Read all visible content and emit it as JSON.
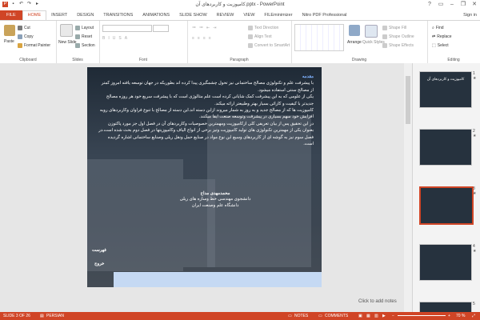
{
  "window": {
    "title": "کامپوزیت و کاربردهای آن.pptx - PowerPoint",
    "help": "?",
    "signin": "Sign in"
  },
  "tabs": [
    "FILE",
    "HOME",
    "INSERT",
    "DESIGN",
    "TRANSITIONS",
    "ANIMATIONS",
    "SLIDE SHOW",
    "REVIEW",
    "VIEW",
    "FILEminimizer",
    "Nitro PDF Professional"
  ],
  "ribbon": {
    "clipboard": {
      "name": "Clipboard",
      "paste": "Paste",
      "cut": "Cut",
      "copy": "Copy",
      "format_painter": "Format Painter"
    },
    "slides": {
      "name": "Slides",
      "new_slide": "New Slide",
      "layout": "Layout",
      "reset": "Reset",
      "section": "Section"
    },
    "font": {
      "name": "Font"
    },
    "paragraph": {
      "name": "Paragraph",
      "text_direction": "Text Direction",
      "align_text": "Align Text",
      "convert": "Convert to SmartArt"
    },
    "drawing": {
      "name": "Drawing",
      "arrange": "Arrange",
      "quick_styles": "Quick Styles",
      "shape_fill": "Shape Fill",
      "shape_outline": "Shape Outline",
      "shape_effects": "Shape Effects"
    },
    "editing": {
      "name": "Editing",
      "find": "Find",
      "replace": "Replace",
      "select": "Select"
    }
  },
  "slide": {
    "heading": "مقدمه",
    "paragraphs": [
      "با پیشرفت علم و تکنولوژی مصالح ساختمانی نیز تحول چشمگیری پیدا کرده اند بطوریکه در جهان توسعه یافته امروز کمتر از مصالح سنتی استفاده میشود.",
      "یکی از علومی که به این پیشرفت کمک شایانی کرده است علم متالوژی است که با پیشرفت سریع خود هر روزه مصالح جدیدتر با کیفیت و کارائی بسیار بهتر وطبیعتر ارائه میکند.",
      "کامپوزیت ها که از مصالح جدید و به روز به شمار میروند ازاین دسته اند.این دسته از مصالح با تنوع فراوان وکاربردهای روبه افزایش خود سهم بسیاری در پیشرفت وتوسعه صنعت ایفا میکنند.",
      "در این تحقیق پس از بیان تعریفی کلی ازکامپوزیت ومهمترین خصوصیات وکاربردهای آن در فصل اول جز مورد پاکتوزن بعنوان یکی از مهمترین تکنولوژی های تولید کامپوزیت وتیز برخی از انواع الیاف وکامپوزیتها در فصل دوم بحث شده است.در فصل سوم نیز به گوشه ای از کاربردهای وسیع این نوع مواد در صنایع حمل ونقل ریلی وصنایع ساختمانی اشاره گردیده است."
    ],
    "author_name": "محمدمهدی مداح",
    "author_line2": "دانشجوی مهندسی خط وسازه های ریلی",
    "author_line3": "دانشگاه علم وصنعت ایران",
    "nav_list": "فهرست",
    "nav_exit": "خروج"
  },
  "thumbnails": [
    {
      "num": "1",
      "title": "کامپوزیت و کاربردهای آن"
    },
    {
      "num": "2",
      "title": ""
    },
    {
      "num": "3",
      "title": ""
    },
    {
      "num": "4",
      "title": ""
    },
    {
      "num": "5",
      "title": ""
    }
  ],
  "notes_placeholder": "Click to add notes",
  "status": {
    "slide_info": "SLIDE 3 OF 26",
    "language": "PERSIAN",
    "notes": "NOTES",
    "comments": "COMMENTS",
    "zoom": "70 %"
  },
  "colors": {
    "accent": "#d04526",
    "selected_thumb": "#d04526",
    "slide_heading": "#7fb2ff"
  }
}
